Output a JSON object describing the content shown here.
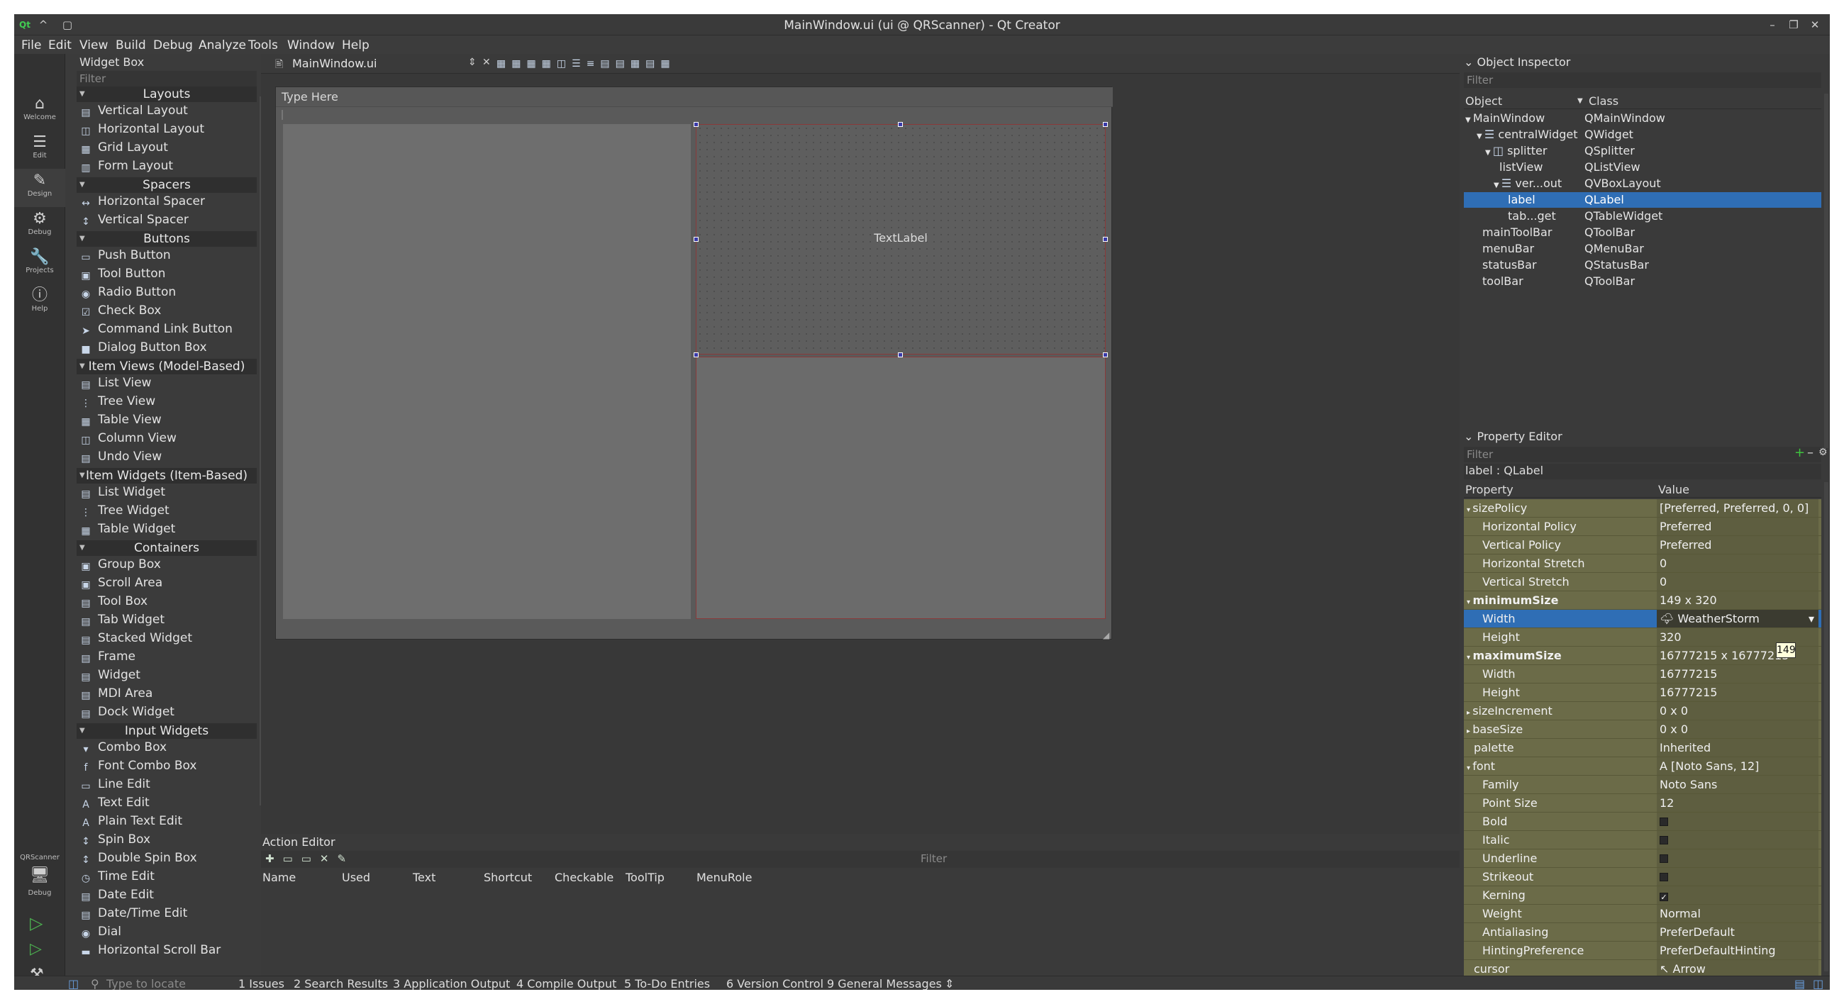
{
  "window": {
    "title": "MainWindow.ui (ui @ QRScanner) - Qt Creator"
  },
  "menubar": [
    "File",
    "Edit",
    "View",
    "Build",
    "Debug",
    "Analyze",
    "Tools",
    "Window",
    "Help"
  ],
  "modes": [
    {
      "label": "Welcome",
      "icon": "home-icon"
    },
    {
      "label": "Edit",
      "icon": "edit-icon"
    },
    {
      "label": "Design",
      "icon": "design-icon"
    },
    {
      "label": "Debug",
      "icon": "debug-icon"
    },
    {
      "label": "Projects",
      "icon": "projects-icon"
    },
    {
      "label": "Help",
      "icon": "help-icon"
    }
  ],
  "kit": {
    "project": "QRScanner",
    "config": "Debug"
  },
  "widget_box": {
    "title": "Widget Box",
    "filter_placeholder": "Filter",
    "categories": {
      "layouts": "Layouts",
      "spacers": "Spacers",
      "buttons": "Buttons",
      "item_views": "Item Views (Model-Based)",
      "item_widgets": "Item Widgets (Item-Based)",
      "containers": "Containers",
      "input_widgets": "Input Widgets"
    },
    "items": [
      "Vertical Layout",
      "Horizontal Layout",
      "Grid Layout",
      "Form Layout",
      "Horizontal Spacer",
      "Vertical Spacer",
      "Push Button",
      "Tool Button",
      "Radio Button",
      "Check Box",
      "Command Link Button",
      "Dialog Button Box",
      "List View",
      "Tree View",
      "Table View",
      "Column View",
      "Undo View",
      "List Widget",
      "Tree Widget",
      "Table Widget",
      "Group Box",
      "Scroll Area",
      "Tool Box",
      "Tab Widget",
      "Stacked Widget",
      "Frame",
      "Widget",
      "MDI Area",
      "Dock Widget",
      "Combo Box",
      "Font Combo Box",
      "Line Edit",
      "Text Edit",
      "Plain Text Edit",
      "Spin Box",
      "Double Spin Box",
      "Time Edit",
      "Date Edit",
      "Date/Time Edit",
      "Dial",
      "Horizontal Scroll Bar"
    ]
  },
  "editor": {
    "file_tab": "MainWindow.ui",
    "form_menu_placeholder": "Type Here",
    "text_label": "TextLabel"
  },
  "action_editor": {
    "title": "Action Editor",
    "filter_placeholder": "Filter",
    "columns": [
      "Name",
      "Used",
      "Text",
      "Shortcut",
      "Checkable",
      "ToolTip",
      "MenuRole"
    ]
  },
  "object_inspector": {
    "title": "Object Inspector",
    "filter_placeholder": "Filter",
    "col_object": "Object",
    "col_class": "Class",
    "rows": [
      {
        "object": "MainWindow",
        "class": "QMainWindow"
      },
      {
        "object": "centralWidget",
        "class": "QWidget"
      },
      {
        "object": "splitter",
        "class": "QSplitter"
      },
      {
        "object": "listView",
        "class": "QListView"
      },
      {
        "object": "ver...out",
        "class": "QVBoxLayout"
      },
      {
        "object": "label",
        "class": "QLabel"
      },
      {
        "object": "tab...get",
        "class": "QTableWidget"
      },
      {
        "object": "mainToolBar",
        "class": "QToolBar"
      },
      {
        "object": "menuBar",
        "class": "QMenuBar"
      },
      {
        "object": "statusBar",
        "class": "QStatusBar"
      },
      {
        "object": "toolBar",
        "class": "QToolBar"
      }
    ]
  },
  "property_editor": {
    "title": "Property Editor",
    "filter_placeholder": "Filter",
    "context": "label : QLabel",
    "col_property": "Property",
    "col_value": "Value",
    "rows": [
      {
        "name": "sizePolicy",
        "value": "[Preferred, Preferred, 0, 0]"
      },
      {
        "name": "Horizontal Policy",
        "value": "Preferred"
      },
      {
        "name": "Vertical Policy",
        "value": "Preferred"
      },
      {
        "name": "Horizontal Stretch",
        "value": "0"
      },
      {
        "name": "Vertical Stretch",
        "value": "0"
      },
      {
        "name": "minimumSize",
        "value": "149 x 320"
      },
      {
        "name": "Width",
        "value": "WeatherStorm"
      },
      {
        "name": "Height",
        "value": "320"
      },
      {
        "name": "maximumSize",
        "value": "16777215 x 16777215"
      },
      {
        "name": "Width",
        "value": "16777215"
      },
      {
        "name": "Height",
        "value": "16777215"
      },
      {
        "name": "sizeIncrement",
        "value": "0 x 0"
      },
      {
        "name": "baseSize",
        "value": "0 x 0"
      },
      {
        "name": "palette",
        "value": "Inherited"
      },
      {
        "name": "font",
        "value": "[Noto Sans, 12]"
      },
      {
        "name": "Family",
        "value": "Noto Sans"
      },
      {
        "name": "Point Size",
        "value": "12"
      },
      {
        "name": "Bold",
        "value": ""
      },
      {
        "name": "Italic",
        "value": ""
      },
      {
        "name": "Underline",
        "value": ""
      },
      {
        "name": "Strikeout",
        "value": ""
      },
      {
        "name": "Kerning",
        "value": ""
      },
      {
        "name": "Weight",
        "value": "Normal"
      },
      {
        "name": "Antialiasing",
        "value": "PreferDefault"
      },
      {
        "name": "HintingPreference",
        "value": "PreferDefaultHinting"
      },
      {
        "name": "cursor",
        "value": "Arrow"
      }
    ],
    "tooltip": "149",
    "checkbox_states": {
      "Bold": false,
      "Italic": false,
      "Underline": false,
      "Strikeout": false,
      "Kerning": true
    }
  },
  "status_bar": {
    "locate_placeholder": "Type to locate",
    "tabs": [
      "1 Issues",
      "2 Search Results",
      "3 Application Output",
      "4 Compile Output",
      "5 To-Do Entries",
      "6 Version Control",
      "9 General Messages"
    ]
  }
}
